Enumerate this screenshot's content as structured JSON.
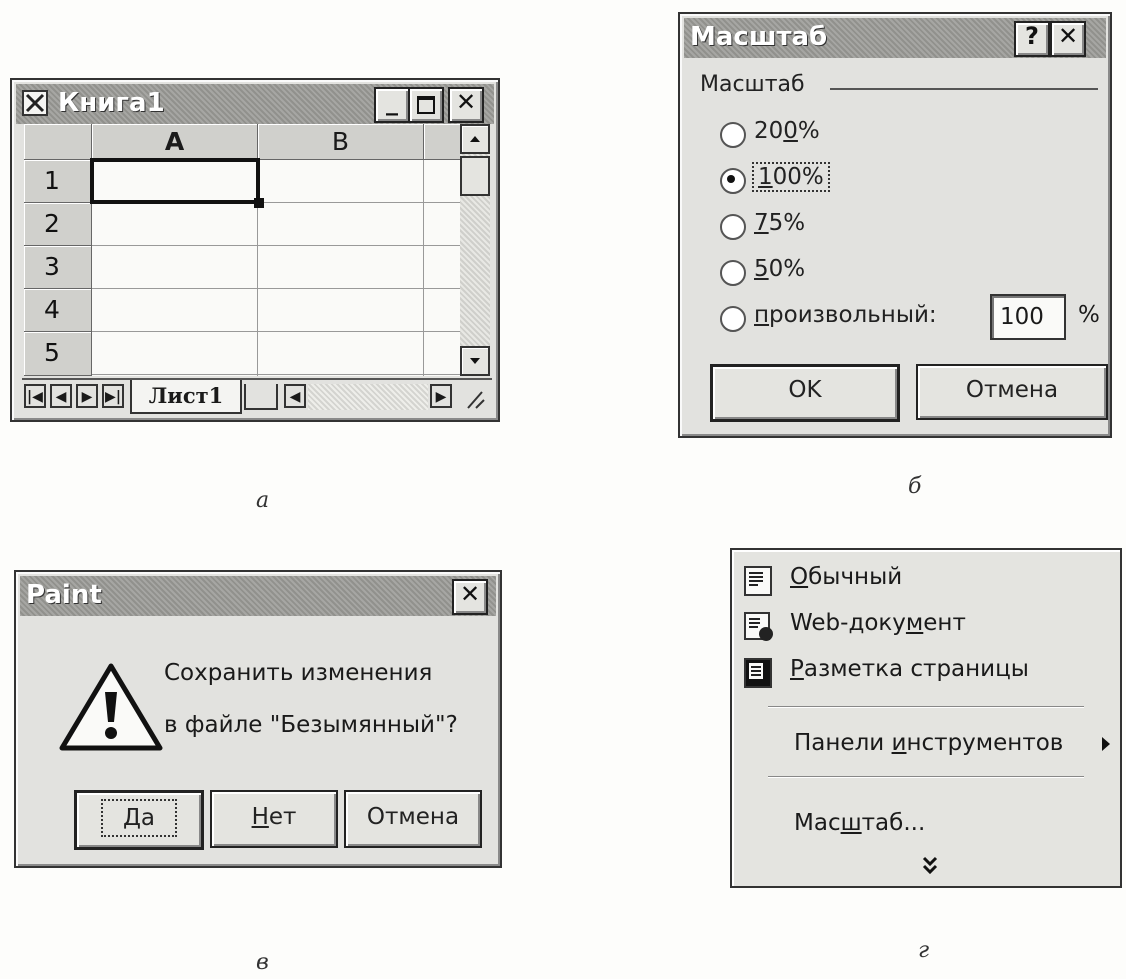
{
  "excel": {
    "title": "Книга1",
    "columns": [
      "A",
      "B"
    ],
    "rows": [
      "1",
      "2",
      "3",
      "4",
      "5"
    ],
    "sheet_tab": "Лист1",
    "caption": "а"
  },
  "zoom": {
    "title": "Масштаб",
    "help_label": "?",
    "group_label": "Масштаб",
    "options": [
      {
        "pre": "20",
        "key": "0",
        "post": "%",
        "checked": false
      },
      {
        "pre": "",
        "key": "1",
        "post": "00%",
        "checked": true
      },
      {
        "pre": "",
        "key": "7",
        "post": "5%",
        "checked": false
      },
      {
        "pre": "",
        "key": "5",
        "post": "0%",
        "checked": false
      },
      {
        "pre": "",
        "key": "п",
        "post": "роизвольный:",
        "checked": false
      }
    ],
    "custom_value": "100",
    "percent_sign": "%",
    "ok_label": "OK",
    "cancel_label": "Отмена",
    "caption": "б"
  },
  "paint": {
    "title": "Paint",
    "message_line1": "Сохранить изменения",
    "message_line2": "в файле \"Безымянный\"?",
    "yes_key": "Д",
    "yes_rest": "а",
    "no_key": "Н",
    "no_rest": "ет",
    "cancel_label": "Отмена",
    "caption": "в"
  },
  "view_menu": {
    "normal_key": "О",
    "normal_rest": "бычный",
    "web_pre": "Web-доку",
    "web_key": "м",
    "web_post": "ент",
    "layout_key": "Р",
    "layout_rest": "азметка страницы",
    "toolbars_pre": "Панели ",
    "toolbars_key": "и",
    "toolbars_post": "нструментов",
    "zoom_pre": "Мас",
    "zoom_key": "ш",
    "zoom_post": "таб...",
    "caption": "г"
  }
}
